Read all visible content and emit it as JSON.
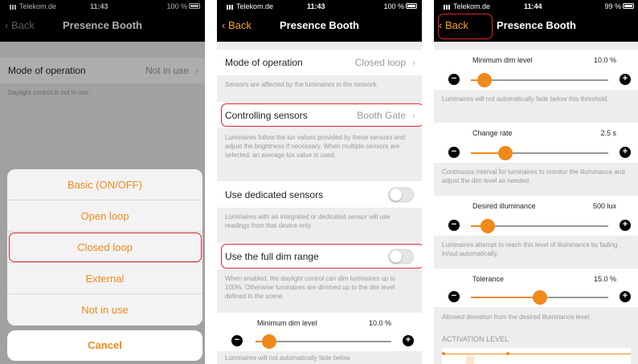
{
  "status": {
    "carrier": "Telekom.de",
    "p1_time": "11:43",
    "p1_battery": "100 %",
    "p2_time": "11:43",
    "p2_battery": "100 %",
    "p3_time": "11:44",
    "p3_battery": "99 %"
  },
  "nav": {
    "back": "Back",
    "title": "Presence Booth"
  },
  "panel1": {
    "mode_label": "Mode of operation",
    "mode_value": "Not in use",
    "note": "Daylight control is not in use.",
    "sheet": [
      "Basic (ON/OFF)",
      "Open loop",
      "Closed loop",
      "External",
      "Not in use"
    ],
    "cancel": "Cancel"
  },
  "panel2": {
    "mode_label": "Mode of operation",
    "mode_value": "Closed loop",
    "mode_note": "Sensors are affected by the luminaires in the network.",
    "ctrl_label": "Controlling sensors",
    "ctrl_value": "Booth Gate",
    "ctrl_note": "Luminaires follow the lux values provided by these sensors and adjust the brightness if necessary. When multiple sensors are selected, an average lux value is used.",
    "dedicated_label": "Use dedicated sensors",
    "dedicated_note": "Luminaires with an integrated or dedicated sensor will use readings from that device only.",
    "fullrange_label": "Use the full dim range",
    "fullrange_note": "When enabled, the daylight control can dim luminaires up to 100%. Otherwise luminaires are dimmed up to the dim level defined in the scene.",
    "min_dim_label": "Minimum dim level",
    "min_dim_value": "10.0 %",
    "min_dim_note": "Luminaires will not automatically fade below"
  },
  "panel3": {
    "min_dim_label": "Minimum dim level",
    "min_dim_value": "10.0 %",
    "min_dim_note": "Luminaires will not automatically fade below this threshold.",
    "rate_label": "Change rate",
    "rate_value": "2.5 s",
    "rate_note": "Continuous interval for luminaires to monitor the illuminance and adjust the dim level as needed.",
    "desired_label": "Desired illuminance",
    "desired_value": "500 lux",
    "desired_note": "Luminaires attempt to reach this level of illuminance by fading in/out automatically.",
    "tol_label": "Tolerance",
    "tol_value": "15.0 %",
    "tol_note": "Allowed deviation from the desired illuminance level.",
    "activation": "ACTIVATION LEVEL"
  },
  "slider_levels": {
    "p2_min_dim": 0.1,
    "p3_min_dim": 0.1,
    "p3_rate": 0.25,
    "p3_desired": 0.12,
    "p3_tol": 0.5
  },
  "colors": {
    "accent": "#f0891b",
    "highlight": "#e0232d"
  }
}
